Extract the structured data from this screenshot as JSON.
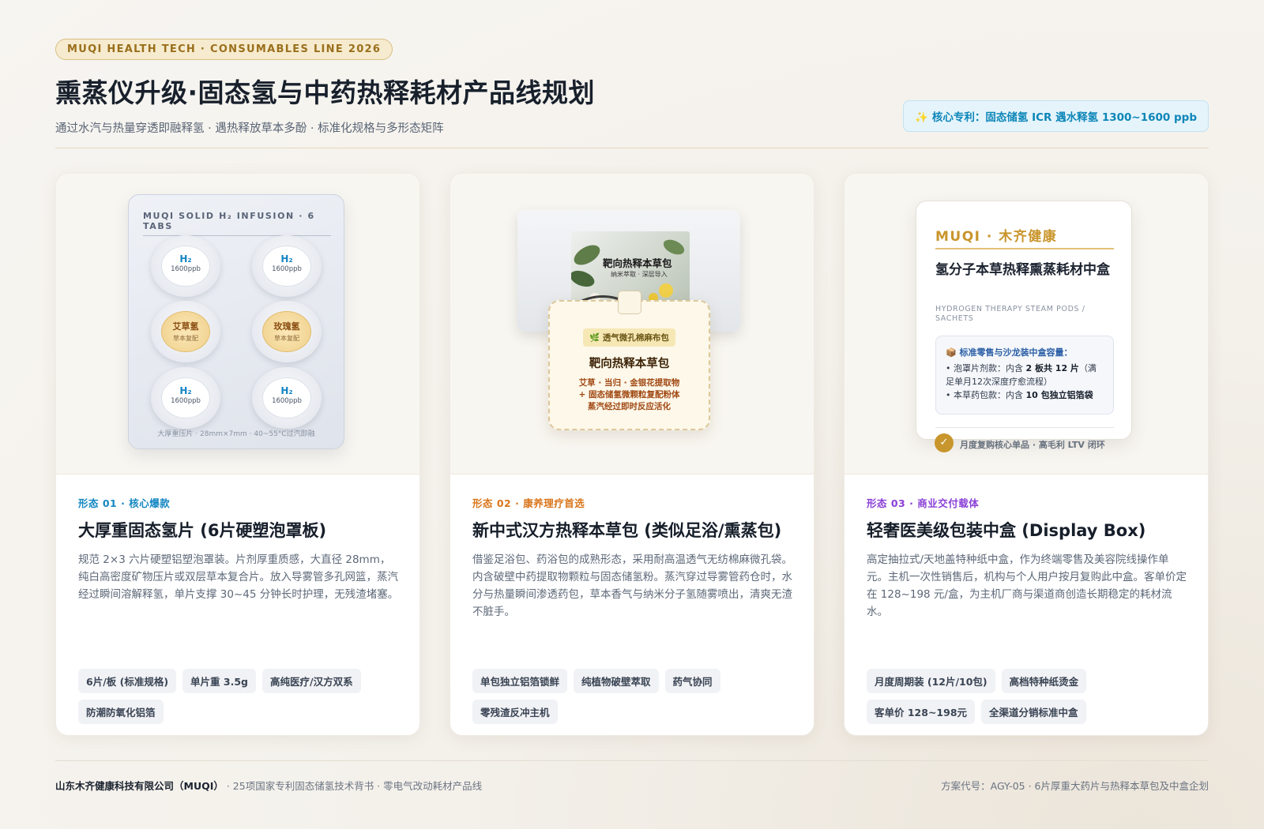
{
  "header": {
    "tag": "MUQI HEALTH TECH · CONSUMABLES LINE 2026",
    "title": "熏蒸仪升级·固态氢与中药热释耗材产品线规划",
    "subtitle": "通过水汽与热量穿透即融释氢 · 遇热释放草本多酚 · 标准化规格与多形态矩阵",
    "patent": "✨ 核心专利：固态储氢 ICR 遇水释氢 1300~1600 ppb"
  },
  "cards": [
    {
      "kicker": "形态 01 · 核心爆款",
      "kicker_color": "#1587c2",
      "title": "大厚重固态氢片 (6片硬塑泡罩板)",
      "desc": "规范 2×3 六片硬塑铝塑泡罩装。片剂厚重质感，大直径 28mm，纯白高密度矿物压片或双层草本复合片。放入导雾管多孔网篮，蒸汽经过瞬间溶解释氢，单片支撑 30~45 分钟长时护理，无残渣堵塞。",
      "chips": [
        "6片/板 (标准规格)",
        "单片重 3.5g",
        "高纯医疗/汉方双系",
        "防潮防氧化铝箔"
      ],
      "visual": {
        "head": "MUQI SOLID H₂ INFUSION · 6 TABS",
        "foot": "大厚重压片 · 28mm×7mm · 40~55°C过汽即融",
        "h2_label": "H₂",
        "ppb_label": "1600ppb",
        "herb1": "艾草氢",
        "herb2": "玫瑰氢",
        "herb_sub": "草本复配"
      }
    },
    {
      "kicker": "形态 02 · 康养理疗首选",
      "kicker_color": "#d9761b",
      "title": "新中式汉方热释本草包 (类似足浴/熏蒸包)",
      "desc": "借鉴足浴包、药浴包的成熟形态，采用耐高温透气无纺棉麻微孔袋。内含破壁中药提取物颗粒与固态储氢粉。蒸汽穿过导雾管药仓时，水分与热量瞬间渗透药包，草本香气与纳米分子氢随雾喷出，清爽无渣不脏手。",
      "chips": [
        "单包独立铝箔锁鲜",
        "纯植物破壁萃取",
        "药气协同",
        "零残渣反冲主机"
      ],
      "visual": {
        "pack_title": "靶向热释本草包",
        "pack_sub": "纳米萃取 · 深层导入",
        "badge": "🌿 透气微孔棉麻布包",
        "sachet_title": "靶向热释本草包",
        "line1": "艾草 · 当归 · 金银花提取物",
        "line2": "+ 固态储氢微颗粒复配粉体",
        "line3": "蒸汽经过即时反应活化"
      }
    },
    {
      "kicker": "形态 03 · 商业交付载体",
      "kicker_color": "#8a3fd6",
      "title": "轻奢医美级包装中盒 (Display Box)",
      "desc": "高定抽拉式/天地盖特种纸中盒，作为终端零售及美容院线操作单元。主机一次性销售后，机构与个人用户按月复购此中盒。客单价定在 128~198 元/盒，为主机厂商与渠道商创造长期稳定的耗材流水。",
      "chips": [
        "月度周期装 (12片/10包)",
        "高档特种纸烫金",
        "客单价 128~198元",
        "全渠道分销标准中盒"
      ],
      "visual": {
        "brand": "MUQI · 木齐健康",
        "box_title": "氢分子本草热释熏蒸耗材中盒",
        "box_en": "HYDROGEN THERAPY STEAM PODS / SACHETS",
        "info_head": "📦 标准零售与沙龙装中盒容量：",
        "info1_pre": "• 泡罩片剂款：内含 ",
        "info1_b": "2 板共 12 片",
        "info1_post": "（满足单月12次深度疗愈流程）",
        "info2_pre": "• 本草药包款：内含 ",
        "info2_b": "10 包独立铝箔袋",
        "check_text": "月度复购核心单品 · 高毛利 LTV 闭环"
      }
    }
  ],
  "footer": {
    "company": "山东木齐健康科技有限公司（MUQI）",
    "left_text": " · 25项国家专利固态储氢技术背书 · 零电气改动耗材产品线",
    "right_text": "方案代号：AGY-05 · 6片厚重大药片与热释本草包及中盒企划"
  }
}
